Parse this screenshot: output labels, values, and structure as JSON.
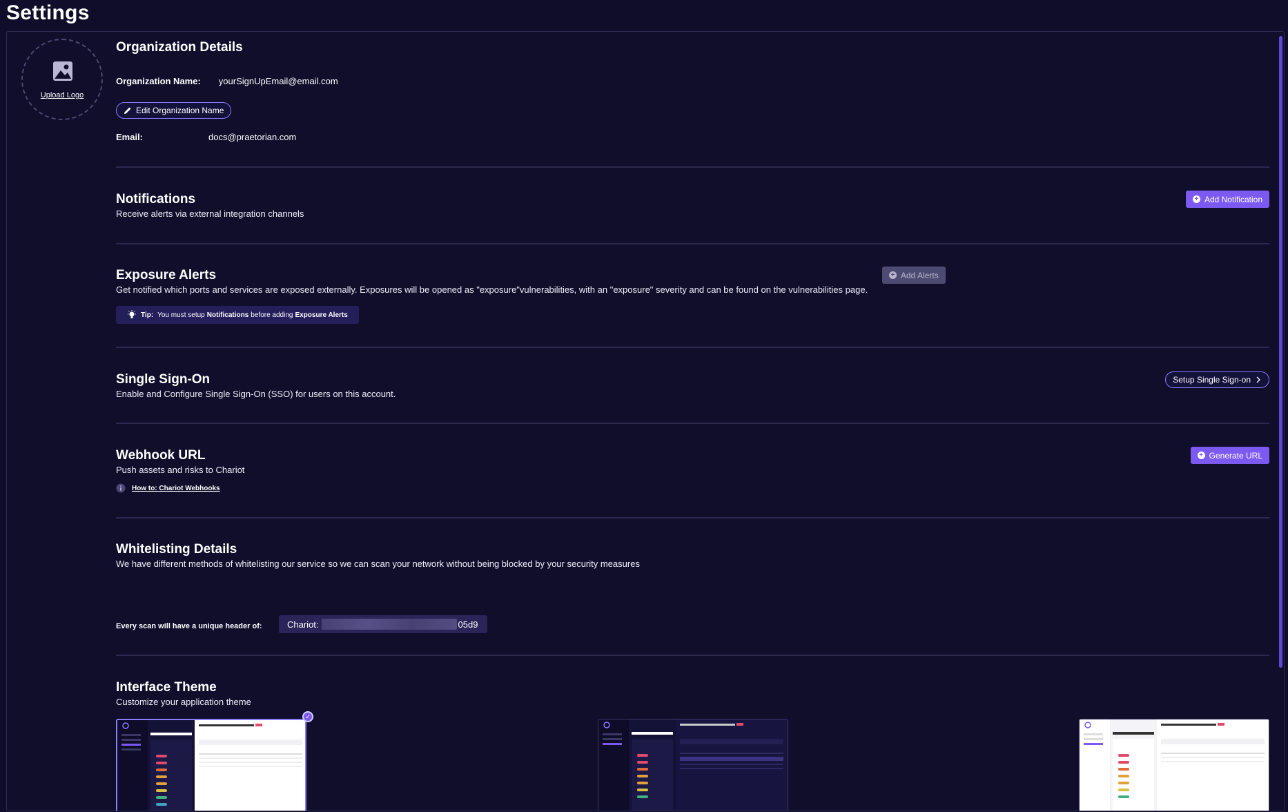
{
  "page": {
    "title": "Settings"
  },
  "logo": {
    "upload_label": "Upload Logo"
  },
  "organization": {
    "heading": "Organization Details",
    "name_label": "Organization Name:",
    "name_value": "yourSignUpEmail@email.com",
    "edit_button": "Edit Organization Name",
    "email_label": "Email:",
    "email_value": "docs@praetorian.com"
  },
  "notifications": {
    "heading": "Notifications",
    "description": "Receive alerts via external integration channels",
    "button": "Add Notification"
  },
  "exposure_alerts": {
    "heading": "Exposure Alerts",
    "description": "Get notified which ports and services are exposed externally. Exposures will be opened as \"exposure\"vulnerabilities, with an \"exposure\" severity and can be found on the vulnerabilities page.",
    "button": "Add Alerts",
    "tip_prefix": "Tip:",
    "tip_text_1": "You must setup",
    "tip_bold_1": "Notifications",
    "tip_text_2": "before adding",
    "tip_bold_2": "Exposure Alerts"
  },
  "sso": {
    "heading": "Single Sign-On",
    "description": "Enable and Configure Single Sign-On (SSO) for users on this account.",
    "button": "Setup Single Sign-on"
  },
  "webhook": {
    "heading": "Webhook URL",
    "description": "Push assets and risks to Chariot",
    "button": "Generate URL",
    "help_link": "How to: Chariot Webhooks"
  },
  "whitelisting": {
    "heading": "Whitelisting Details",
    "description": "We have different methods of whitelisting our service so we can scan your network without being blocked by your security measures",
    "header_label": "Every scan will have a unique header of:",
    "header_prefix": "Chariot:",
    "header_suffix": "05d9"
  },
  "theme": {
    "heading": "Interface Theme",
    "description": "Customize your application theme",
    "selected": "dark-light"
  }
}
